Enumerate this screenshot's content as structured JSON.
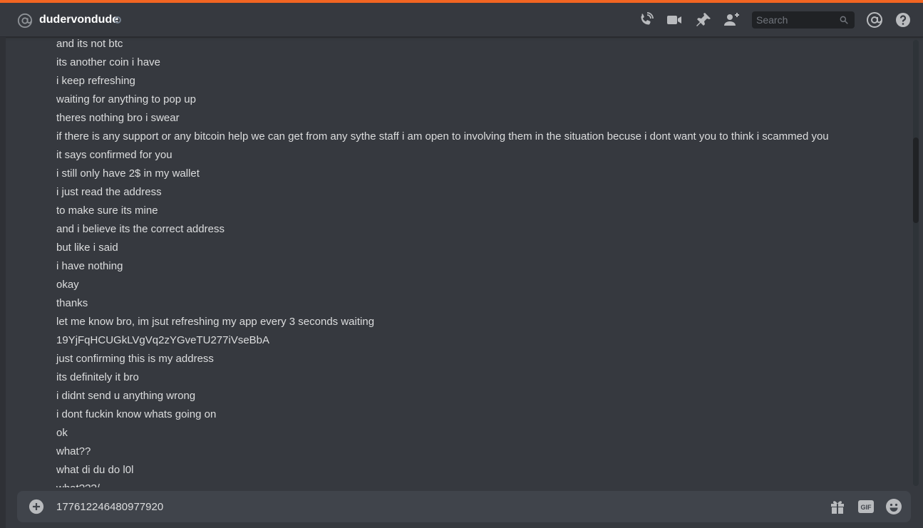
{
  "header": {
    "title": "dudervondude",
    "search_placeholder": "Search",
    "icons": [
      "at-icon",
      "voice-call-icon",
      "video-call-icon",
      "pin-icon",
      "add-friend-icon",
      "search-icon",
      "mentions-icon",
      "help-icon"
    ]
  },
  "messages": [
    "and its not btc",
    "its another coin i have",
    "i keep refreshing",
    "waiting for anything to pop up",
    "theres nothing bro i swear",
    "if there is any support or any bitcoin help we can get from any sythe staff i am open to involving them in the situation becuse i dont want you to think i scammed you",
    "it says confirmed for you",
    "i still only have 2$ in my wallet",
    "i just read the address",
    "to make sure its mine",
    "and i believe its the correct address",
    "but like i said",
    "i have nothing",
    "okay",
    "thanks",
    "let me know bro, im jsut refreshing my app every 3 seconds waiting",
    "19YjFqHCUGkLVgVq2zYGveTU277iVseBbA",
    "just confirming this is my address",
    "its definitely it bro",
    "i didnt send u anything wrong",
    "i dont fuckin know whats going on",
    "ok",
    "what??",
    "what di du do l0l",
    "what???/"
  ],
  "composer": {
    "value": "177612246480977920",
    "icons": [
      "plus-circle-icon",
      "gift-icon",
      "gif-icon",
      "emoji-icon"
    ],
    "gif_label": "GIF"
  },
  "colors": {
    "accent": "#f26522",
    "background": "#36393f",
    "text": "#dcddde",
    "input_bg": "#40444b"
  }
}
